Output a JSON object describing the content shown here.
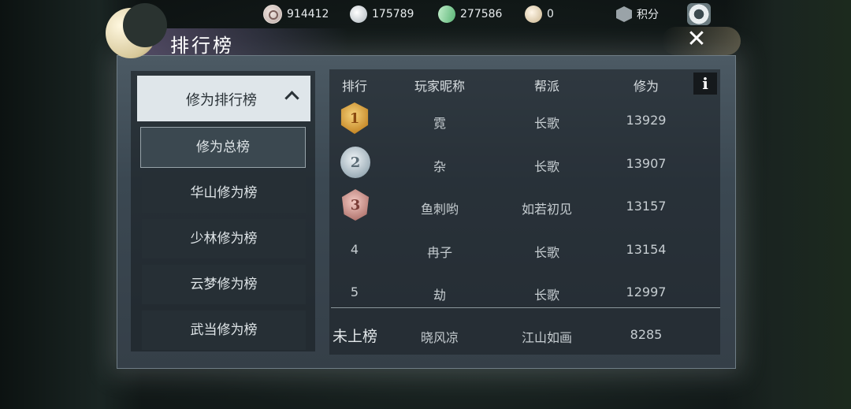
{
  "resources": [
    {
      "icon": "coin-icon",
      "value": "914412"
    },
    {
      "icon": "silver-icon",
      "value": "175789"
    },
    {
      "icon": "jade-icon",
      "value": "277586"
    },
    {
      "icon": "bag-icon",
      "value": "0"
    }
  ],
  "score": {
    "label": "积分",
    "icon": "shield-icon"
  },
  "title": "排行榜",
  "sidebar": {
    "header": "修为排行榜",
    "items": [
      {
        "label": "修为总榜",
        "active": true
      },
      {
        "label": "华山修为榜",
        "active": false
      },
      {
        "label": "少林修为榜",
        "active": false
      },
      {
        "label": "云梦修为榜",
        "active": false
      },
      {
        "label": "武当修为榜",
        "active": false
      }
    ]
  },
  "table": {
    "headers": [
      "排行",
      "玩家昵称",
      "帮派",
      "修为"
    ],
    "info_label": "i",
    "rows": [
      {
        "rank": "1",
        "badge": "gold-medal-icon",
        "name": "霓",
        "guild": "长歌",
        "value": "13929"
      },
      {
        "rank": "2",
        "badge": "silver-medal-icon",
        "name": "杂",
        "guild": "长歌",
        "value": "13907"
      },
      {
        "rank": "3",
        "badge": "bronze-medal-icon",
        "name": "鱼刺哟",
        "guild": "如若初见",
        "value": "13157"
      },
      {
        "rank": "4",
        "name": "冉子",
        "guild": "长歌",
        "value": "13154"
      },
      {
        "rank": "5",
        "name": "劫",
        "guild": "长歌",
        "value": "12997"
      }
    ],
    "self": {
      "rank": "未上榜",
      "name": "晓风凉",
      "guild": "江山如画",
      "value": "8285"
    }
  },
  "colors": {
    "panel": "#3b4852",
    "header_bg": "#dfe6ea",
    "gold": "#c78a2a"
  }
}
